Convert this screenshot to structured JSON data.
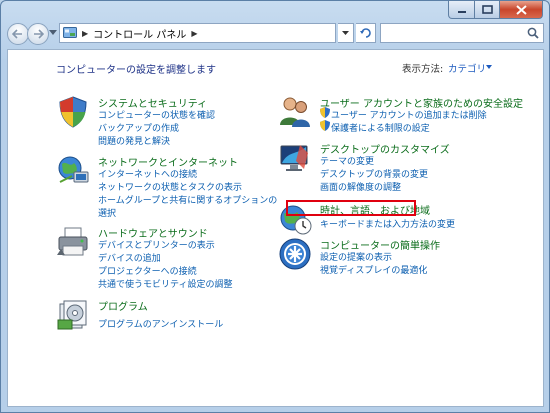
{
  "window": {
    "caption": {
      "minimize": "minimize",
      "maximize": "maximize",
      "close": "close"
    }
  },
  "address": {
    "path": [
      "コントロール パネル"
    ],
    "search_placeholder": ""
  },
  "content": {
    "heading": "コンピューターの設定を調整します",
    "view_by_label": "表示方法:",
    "view_by_value": "カテゴリ"
  },
  "left_categories": [
    {
      "title": "システムとセキュリティ",
      "icon": "shield-flag-icon",
      "links": [
        "コンピューターの状態を確認",
        "バックアップの作成",
        "問題の発見と解決"
      ]
    },
    {
      "title": "ネットワークとインターネット",
      "icon": "network-globe-icon",
      "links": [
        "インターネットへの接続",
        "ネットワークの状態とタスクの表示",
        "ホームグループと共有に関するオプションの",
        "選択"
      ]
    },
    {
      "title": "ハードウェアとサウンド",
      "icon": "printer-icon",
      "links": [
        "デバイスとプリンターの表示",
        "デバイスの追加",
        "プロジェクターへの接続",
        "共通で使うモビリティ設定の調整"
      ]
    },
    {
      "title": "プログラム",
      "icon": "programs-disc-icon",
      "links": [
        "プログラムのアンインストール"
      ]
    }
  ],
  "right_categories": [
    {
      "title": "ユーザー アカウントと家族のための安全設定",
      "icon": "users-icon",
      "links": [
        "ユーザー アカウントの追加または削除",
        "保護者による制限の設定"
      ]
    },
    {
      "title": "デスクトップのカスタマイズ",
      "icon": "desktop-monitor-icon",
      "links": [
        "テーマの変更",
        "デスクトップの背景の変更",
        "画面の解像度の調整"
      ]
    },
    {
      "title": "時計、言語、および地域",
      "icon": "clock-globe-icon",
      "links": [
        "キーボードまたは入力方法の変更"
      ]
    },
    {
      "title": "コンピューターの簡単操作",
      "icon": "ease-of-access-icon",
      "links": [
        "設定の提案の表示",
        "視覚ディスプレイの最適化"
      ]
    }
  ],
  "colors": {
    "category_title": "#0a6c1a",
    "link": "#0c5fb0",
    "heading": "#1e3287",
    "highlight_box": "#e0000f"
  }
}
